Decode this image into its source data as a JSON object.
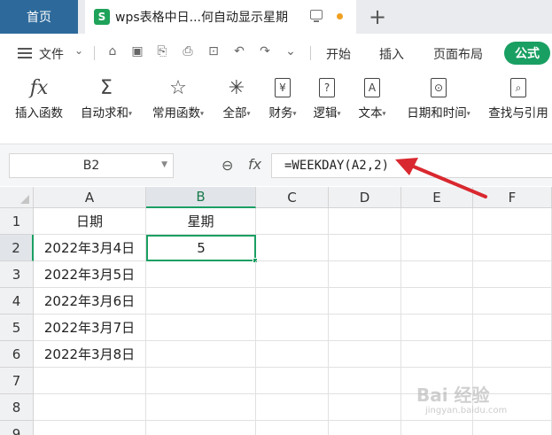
{
  "tabs": {
    "home_label": "首页",
    "doc_icon_letter": "S",
    "doc_title": "wps表格中日...何自动显示星期"
  },
  "menu": {
    "file_label": "文件",
    "tabs": [
      "开始",
      "插入",
      "页面布局",
      "公式"
    ],
    "active_tab": "公式"
  },
  "ribbon": {
    "items": [
      {
        "icon": "fx",
        "label": "插入函数",
        "dropdown": false
      },
      {
        "icon": "Σ",
        "label": "自动求和",
        "dropdown": true
      },
      {
        "icon": "☆",
        "label": "常用函数",
        "dropdown": true
      },
      {
        "icon": "✳",
        "label": "全部",
        "dropdown": true
      },
      {
        "icon": "¥",
        "label": "财务",
        "dropdown": true
      },
      {
        "icon": "?",
        "label": "逻辑",
        "dropdown": true
      },
      {
        "icon": "A",
        "label": "文本",
        "dropdown": true
      },
      {
        "icon": "⊙",
        "label": "日期和时间",
        "dropdown": true
      },
      {
        "icon": "⌕",
        "label": "查找与引用",
        "dropdown": false
      }
    ]
  },
  "formula_bar": {
    "cell_ref": "B2",
    "fx_label": "fx",
    "formula": "=WEEKDAY(A2,2)"
  },
  "sheet": {
    "columns": [
      "A",
      "B",
      "C",
      "D",
      "E",
      "F"
    ],
    "rows": [
      "1",
      "2",
      "3",
      "4",
      "5",
      "6",
      "7",
      "8",
      "9"
    ],
    "selected_cell": "B2",
    "cells": {
      "A1": "日期",
      "B1": "星期",
      "A2": "2022年3月4日",
      "B2": "5",
      "A3": "2022年3月5日",
      "A4": "2022年3月6日",
      "A5": "2022年3月7日",
      "A6": "2022年3月8日"
    }
  },
  "colors": {
    "accent": "#1a9f63",
    "home_tab": "#2d6a9b",
    "annotation_arrow": "#d9282f"
  },
  "watermark": {
    "text": "Bai 经验",
    "sub": "jingyan.baidu.com"
  }
}
